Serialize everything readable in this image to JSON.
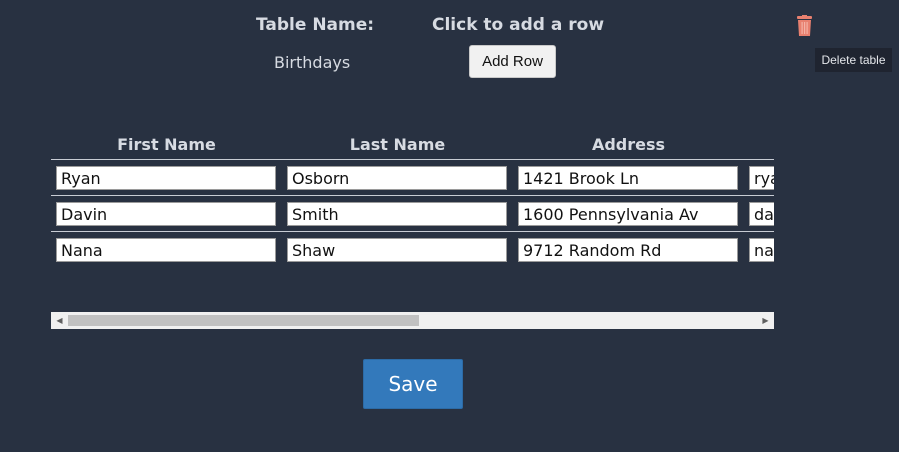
{
  "header": {
    "table_name_label": "Table Name:",
    "table_name_value": "Birthdays",
    "add_row_label": "Click to add a row",
    "add_row_button": "Add Row"
  },
  "delete_table": {
    "icon": "trash-icon",
    "tooltip": "Delete table",
    "icon_color": "#e8806f"
  },
  "table": {
    "columns": [
      "First Name",
      "Last Name",
      "Address",
      ""
    ],
    "rows": [
      [
        "Ryan",
        "Osborn",
        "1421 Brook Ln",
        "rya"
      ],
      [
        "Davin",
        "Smith",
        "1600 Pennsylvania Av",
        "da"
      ],
      [
        "Nana",
        "Shaw",
        "9712 Random Rd",
        "na"
      ]
    ]
  },
  "scrollbar": {
    "left_arrow": "◀",
    "right_arrow": "▶"
  },
  "save_button": "Save",
  "colors": {
    "background": "#283141",
    "accent": "#3379bb"
  }
}
